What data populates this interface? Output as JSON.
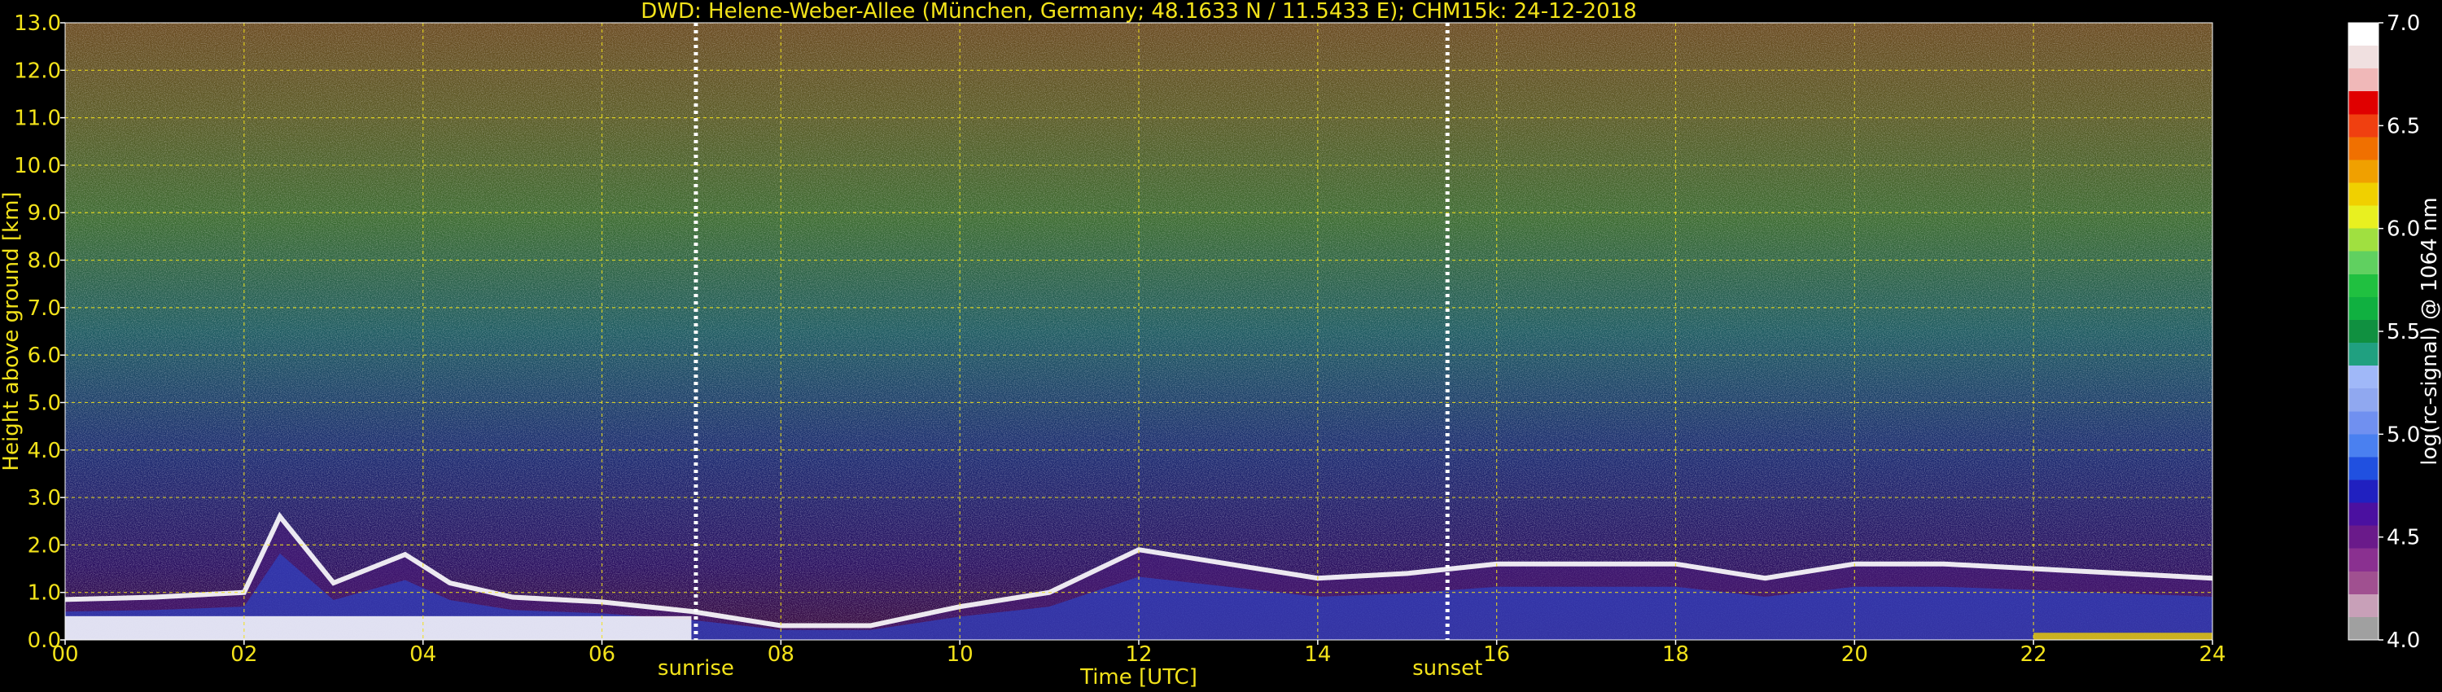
{
  "chart_data": {
    "type": "heatmap",
    "title": "DWD: Helene-Weber-Allee (München, Germany; 48.1633 N / 11.5433 E);    CHM15k: 24-12-2018",
    "xlabel": "Time [UTC]",
    "ylabel": "Height above ground [km]",
    "xlim": [
      0,
      24
    ],
    "ylim": [
      0,
      13
    ],
    "x_ticks": [
      "00",
      "02",
      "04",
      "06",
      "08",
      "10",
      "12",
      "14",
      "16",
      "18",
      "20",
      "22",
      "24"
    ],
    "y_ticks": [
      "0.0",
      "1.0",
      "2.0",
      "3.0",
      "4.0",
      "5.0",
      "6.0",
      "7.0",
      "8.0",
      "9.0",
      "10.0",
      "11.0",
      "12.0",
      "13.0"
    ],
    "grid": true,
    "sun_events": [
      {
        "label": "sunrise",
        "time": 7.05
      },
      {
        "label": "sunset",
        "time": 15.45
      }
    ],
    "colorbar": {
      "label": "log(rc-signal) @ 1064 nm",
      "range": [
        4.0,
        7.0
      ],
      "ticks": [
        "4.0",
        "4.5",
        "5.0",
        "5.5",
        "6.0",
        "6.5",
        "7.0"
      ],
      "colors": [
        "#a0a0a0",
        "#c8a0b8",
        "#a05090",
        "#8a3090",
        "#6a1a8a",
        "#4b10a0",
        "#2020c0",
        "#2050e0",
        "#4a80f0",
        "#7090f0",
        "#90a8f0",
        "#a0b8f8",
        "#20a080",
        "#109040",
        "#10b040",
        "#20c040",
        "#60d060",
        "#a0e040",
        "#e8f020",
        "#f0d000",
        "#f0a000",
        "#f07000",
        "#f04010",
        "#e00000",
        "#f0b8b8",
        "#f0e0e0",
        "#ffffff"
      ]
    },
    "boundary_layer_top_km": [
      [
        0.0,
        0.85
      ],
      [
        1.0,
        0.9
      ],
      [
        2.0,
        1.0
      ],
      [
        2.4,
        2.6
      ],
      [
        3.0,
        1.2
      ],
      [
        3.8,
        1.8
      ],
      [
        4.3,
        1.2
      ],
      [
        5.0,
        0.9
      ],
      [
        6.0,
        0.8
      ],
      [
        7.0,
        0.6
      ],
      [
        8.0,
        0.3
      ],
      [
        9.0,
        0.3
      ],
      [
        10.0,
        0.7
      ],
      [
        11.0,
        1.0
      ],
      [
        12.0,
        1.9
      ],
      [
        13.0,
        1.6
      ],
      [
        14.0,
        1.3
      ],
      [
        15.0,
        1.4
      ],
      [
        16.0,
        1.6
      ],
      [
        17.0,
        1.6
      ],
      [
        18.0,
        1.6
      ],
      [
        19.0,
        1.3
      ],
      [
        20.0,
        1.6
      ],
      [
        21.0,
        1.6
      ],
      [
        22.0,
        1.5
      ],
      [
        23.0,
        1.4
      ],
      [
        24.0,
        1.3
      ]
    ]
  }
}
